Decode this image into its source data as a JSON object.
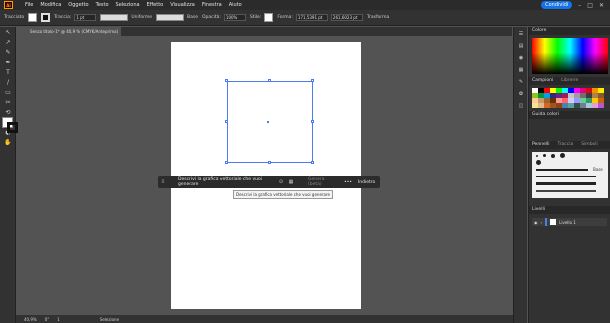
{
  "menubar": {
    "logo": "Ai",
    "items": [
      "File",
      "Modifica",
      "Oggetto",
      "Testo",
      "Seleziona",
      "Effetto",
      "Visualizza",
      "Finestra",
      "Aiuto"
    ],
    "share_label": "Condividi"
  },
  "controlbar": {
    "selection_label": "Tracciato",
    "stroke_label": "Traccia:",
    "stroke_value": "1 pt",
    "stroke_style": "Uniforme",
    "brush_style": "Base",
    "opacity_label": "Opacità:",
    "opacity_value": "100%",
    "style_label": "Stile:",
    "shape_label": "Forma:",
    "x_value": "171,5391 pt",
    "y_value": "261,6023 pt",
    "transform_label": "Trasforma"
  },
  "document": {
    "tab_label": "Senza titolo-1* @ 40,9 % (CMYK/Anteprima)"
  },
  "tools": [
    "↖",
    "↗",
    "✎",
    "✒",
    "T",
    "/",
    "▭",
    "✂",
    "⟲",
    "▧",
    "◐",
    "✋",
    "🔍",
    "⋯"
  ],
  "context_bar": {
    "prompt_placeholder": "Descrivi la grafica vettoriale che vuoi generare",
    "generate_label": "Genera (beta)",
    "more_label": "•••",
    "back_label": "Indietro"
  },
  "tooltip": "Descrivi la grafica vettoriale che vuoi generare",
  "statusbar": {
    "zoom": "40,9%",
    "rotation": "0°",
    "artboard_number": "1",
    "tool_name": "Selezione"
  },
  "panels": {
    "color_title": "Colore",
    "swatches_title": "Campioni",
    "swatches_tab2": "Librerie",
    "color_guide_title": "Guida colori",
    "brushes_title": "Pennelli",
    "brushes_tab2": "Traccia",
    "brushes_tab3": "Simboli",
    "brush_base_label": "Base",
    "layers_title": "Livelli",
    "layer_name": "Livello 1"
  },
  "swatch_colors": [
    "#ffffff",
    "#000000",
    "#ff0000",
    "#ffff00",
    "#00ff00",
    "#00ffff",
    "#0000ff",
    "#ff00ff",
    "#e6007e",
    "#e30613",
    "#f39200",
    "#ffed00",
    "#95c11f",
    "#009640",
    "#009fe3",
    "#312783",
    "#662483",
    "#a3195b",
    "#c6c6c6",
    "#9d9d9d",
    "#706f6f",
    "#3c3c3b",
    "#b17f4a",
    "#8a5a2b",
    "#ffcc99",
    "#cc9966",
    "#996633",
    "#663300",
    "#ff9999",
    "#ff6666",
    "#ccccff",
    "#9999ff",
    "#66cc99",
    "#339966",
    "#ffcc00",
    "#cc6600",
    "#f0e68c",
    "#deb887",
    "#d2691e",
    "#a0522d",
    "#8b4513",
    "#4682b4",
    "#5f9ea0",
    "#2f4f4f",
    "#708090",
    "#b0c4de",
    "#dda0dd",
    "#ba55d3"
  ]
}
